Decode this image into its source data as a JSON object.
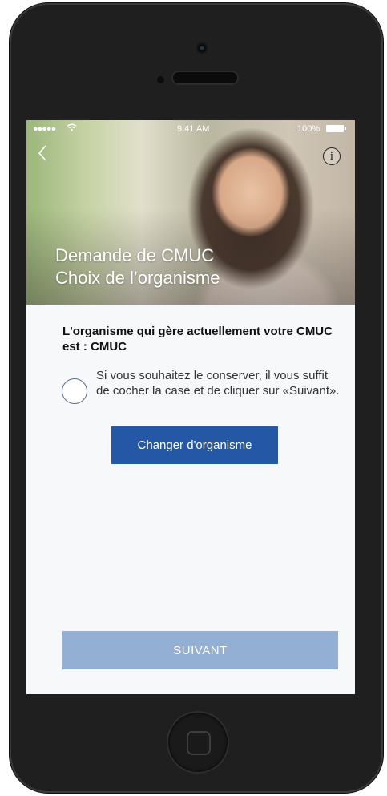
{
  "status_bar": {
    "signal": "●●●●●",
    "time": "9:41 AM",
    "battery": "100%"
  },
  "header": {
    "title_line1": "Demande de CMUC",
    "title_line2": "Choix de l’organisme"
  },
  "content": {
    "heading": "L'organisme qui gère actuellement votre CMUC est : CMUC",
    "keep_help": "Si vous souhaitez le conserver, il vous suffit de cocher la case et de cliquer sur «Suivant».",
    "keep_checked": false,
    "change_button": "Changer d'organisme",
    "next_button": "SUIVANT"
  },
  "icons": {
    "back": "chevron-left-icon",
    "info": "info-icon",
    "wifi": "wifi-icon",
    "battery": "battery-icon"
  },
  "colors": {
    "primary": "#2458a6",
    "next_disabled": "#93b0d4",
    "screen_bg": "#f7f8fa"
  }
}
